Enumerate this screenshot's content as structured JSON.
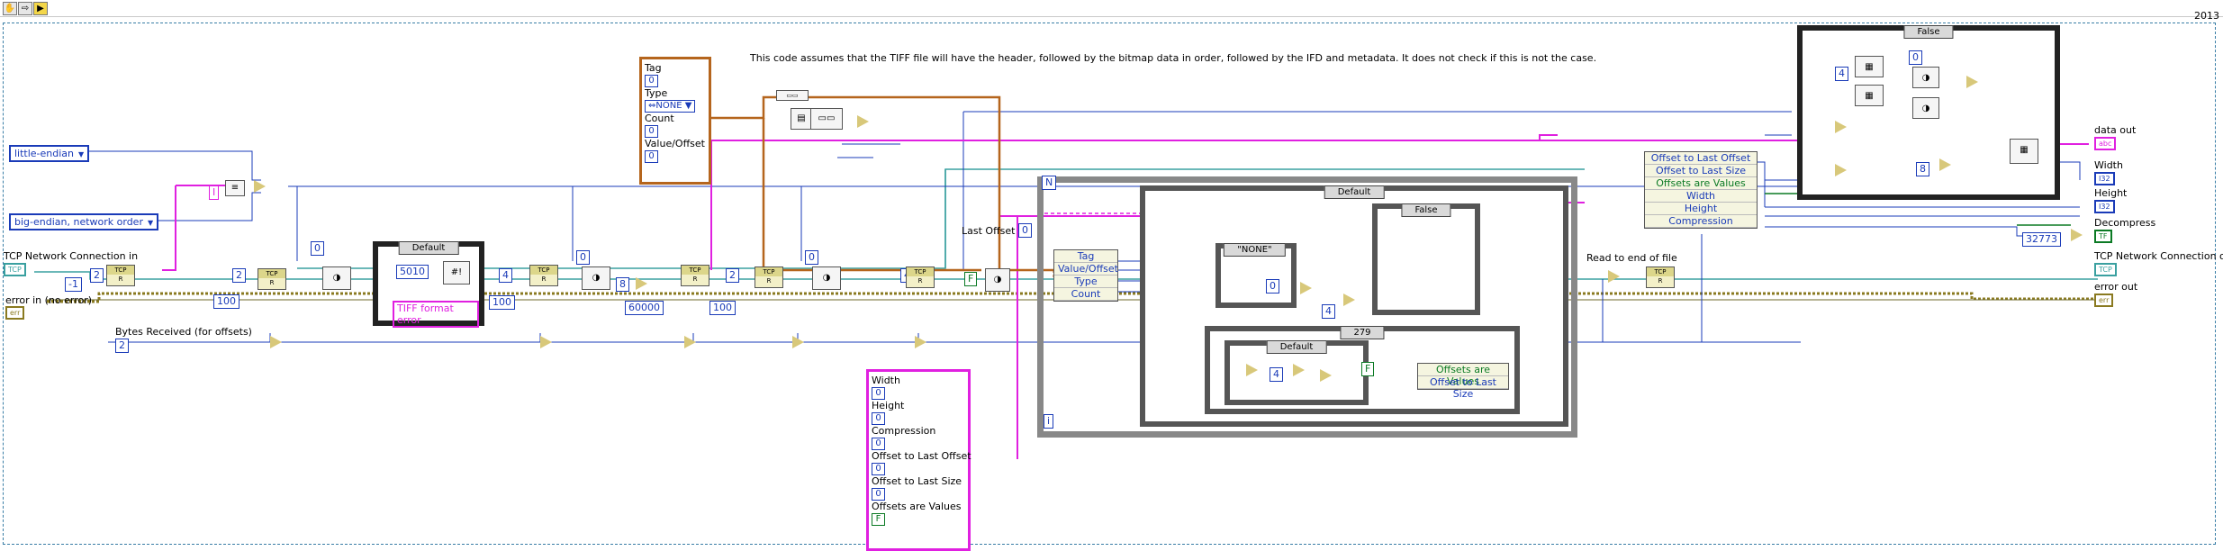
{
  "toolbar": {
    "year": "2013"
  },
  "note": "This code assumes that the TIFF file will have the header, followed by the bitmap data in order, followed by the IFD and metadata. It does not check if this is not the case.",
  "inputs": {
    "little_endian": "little-endian",
    "big_endian": "big-endian, network order",
    "tcp_in_label": "TCP Network Connection in",
    "error_in_label": "error in (no error)",
    "bytes_received_label": "Bytes Received (for offsets)",
    "last_offset_label": "Last Offset",
    "read_to_end_label": "Read to end of file"
  },
  "constants": {
    "neg1": "-1",
    "c2a": "2",
    "c2b": "2",
    "c100a": "100",
    "c100b": "100",
    "c100c": "100",
    "c0a": "0",
    "c0b": "0",
    "c0c": "0",
    "c0d": "0",
    "c4a": "4",
    "c4b": "4",
    "c4c": "4",
    "c4d": "4",
    "c8": "8",
    "c60000": "60000",
    "c5010": "5010",
    "c2c": "2",
    "c2d": "2",
    "c0e": "0",
    "c32773": "32773",
    "c8b": "8",
    "fconst": "F",
    "fconst2": "F",
    "iconst": "I",
    "nconst": "N",
    "iloop": "i",
    "c279": "279"
  },
  "tag_cluster": {
    "tag": "Tag",
    "tag_v": "0",
    "type": "Type",
    "type_v": "NONE",
    "count": "Count",
    "count_v": "0",
    "value": "Value/Offset",
    "value_v": "0"
  },
  "info_cluster": {
    "width": "Width",
    "width_v": "0",
    "height": "Height",
    "height_v": "0",
    "compression": "Compression",
    "compression_v": "0",
    "off_last": "Offset to Last Offset",
    "off_last_v": "0",
    "off_size": "Offset to Last Size",
    "off_size_v": "0",
    "off_values": "Offsets are Values",
    "off_values_v": "F"
  },
  "cases": {
    "default1": "Default",
    "default2": "Default",
    "false1": "False",
    "none_str": "\"NONE\"",
    "c279": "279",
    "default3": "Default",
    "false2": "False"
  },
  "error_const": "TIFF format error",
  "unbundle_main": [
    "Tag",
    "Value/Offset",
    "Type",
    "Count"
  ],
  "bundle_inner": [
    "Offsets are Values",
    "Offset to Last Size"
  ],
  "bundle_big": [
    "Offset to Last Offset",
    "Offset to Last Size",
    "Offsets are Values",
    "Width",
    "Height",
    "Compression"
  ],
  "outputs": {
    "data_out": "data out",
    "width": "Width",
    "height": "Height",
    "decompress": "Decompress",
    "tcp_out": "TCP Network Connection out",
    "error_out": "error out"
  },
  "terminals": {
    "abc": "abc",
    "i32a": "I32",
    "i32b": "I32",
    "tf": "TF",
    "tcp": "TCP",
    "err": "err"
  },
  "colors": {
    "blue_wire": "#1a3bb8",
    "pink_wire": "#e020e0",
    "orange_wire": "#b5651d",
    "green_wire": "#0b7a24",
    "error_wire": "#8a7a20",
    "teal_wire": "#3aa0a0"
  }
}
